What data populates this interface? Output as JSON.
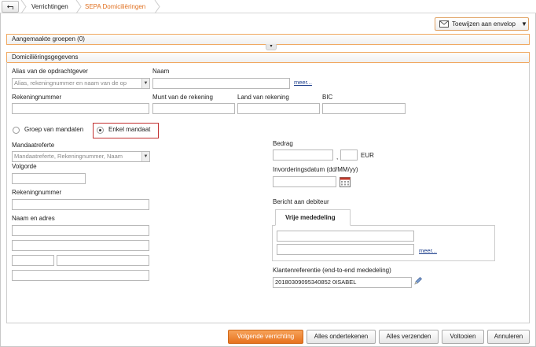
{
  "breadcrumb": {
    "back_icon": "back-arrow-icon",
    "items": [
      "Verrichtingen",
      "SEPA Domiciliëringen"
    ],
    "active_color": "#e07020"
  },
  "toolbar": {
    "envelope_label": "Toewijzen aan envelop",
    "envelope_icon": "envelope-icon"
  },
  "sections": {
    "groups_title": "Aangemaakte groepen (0)",
    "details_title": "Domiciliëringsgegevens"
  },
  "creditor": {
    "alias_label": "Alias van de opdrachtgever",
    "alias_placeholder": "Alias, rekeningnummer en naam van de op",
    "name_label": "Naam",
    "more_link": "meer...",
    "account_label": "Rekeningnummer",
    "currency_label": "Munt van de rekening",
    "country_label": "Land van rekening",
    "bic_label": "BIC"
  },
  "mandate_type": {
    "group_label": "Groep van mandaten",
    "single_label": "Enkel mandaat",
    "selected": "single"
  },
  "mandate": {
    "ref_label": "Mandaatreferte",
    "ref_placeholder": "Mandaatreferte, Rekeningnummer, Naam",
    "sequence_label": "Volgorde",
    "account_label": "Rekeningnummer",
    "name_address_label": "Naam en adres"
  },
  "amount": {
    "label": "Bedrag",
    "separator": ",",
    "currency": "EUR",
    "date_label": "Invorderingsdatum (dd/MM/yy)",
    "calendar_icon": "calendar-icon"
  },
  "message": {
    "label": "Bericht aan debiteur",
    "tab_label": "Vrije mededeling",
    "more_link": "meer...",
    "client_ref_label": "Klantenreferentie (end-to-end mededeling)",
    "client_ref_value": "20180309095340852 0ISABEL",
    "edit_icon": "pencil-icon"
  },
  "footer": {
    "next_label": "Volgende verrichting",
    "sign_all_label": "Alles ondertekenen",
    "send_all_label": "Alles verzenden",
    "complete_label": "Voltooien",
    "cancel_label": "Annuleren"
  }
}
